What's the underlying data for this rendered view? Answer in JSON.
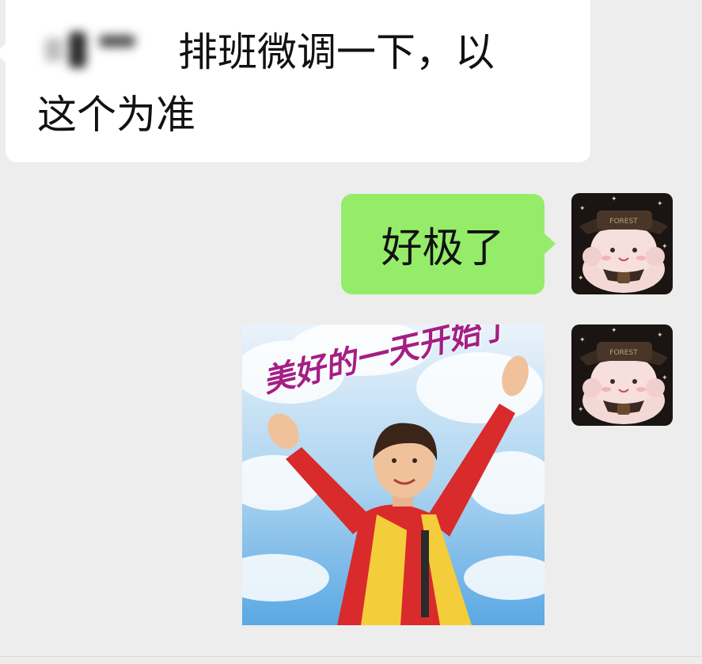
{
  "chat": {
    "incoming": {
      "line1": "排班微调一下，以",
      "line2": "这个为准"
    },
    "outgoing": {
      "text": "好极了"
    },
    "sticker": {
      "caption": "美好的一天开始了",
      "subject_icon": "woman-raising-arms"
    },
    "avatar": {
      "icon": "plush-bear-with-hat",
      "hat_text": "FOREST"
    }
  },
  "colors": {
    "background": "#ededed",
    "incoming_bubble": "#ffffff",
    "outgoing_bubble": "#95ec69",
    "caption": "#a51e84"
  }
}
